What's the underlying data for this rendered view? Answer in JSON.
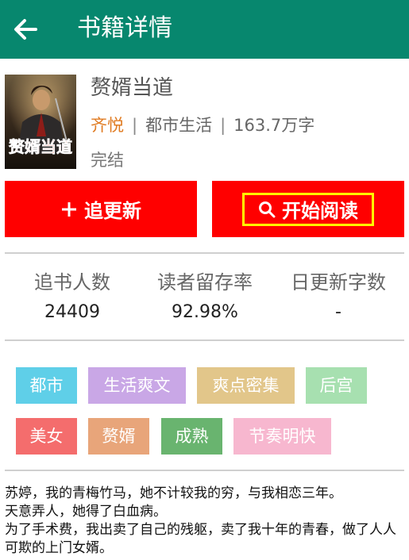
{
  "appbar": {
    "title": "书籍详情"
  },
  "book": {
    "title": "赘婿当道",
    "author": "齐悦",
    "category": "都市生活",
    "word_count": "163.7万字",
    "status": "完结",
    "cover_text": "赘婿当道"
  },
  "actions": {
    "follow_label": "追更新",
    "read_label": "开始阅读"
  },
  "stats": [
    {
      "label": "追书人数",
      "value": "24409"
    },
    {
      "label": "读者留存率",
      "value": "92.98%"
    },
    {
      "label": "日更新字数",
      "value": "-"
    }
  ],
  "tags": [
    {
      "label": "都市",
      "color": "#5fcfe8"
    },
    {
      "label": "生活爽文",
      "color": "#c9a7e6"
    },
    {
      "label": "爽点密集",
      "color": "#e2c68a"
    },
    {
      "label": "后宫",
      "color": "#a7e0b0"
    },
    {
      "label": "美女",
      "color": "#f46d6d"
    },
    {
      "label": "赘婿",
      "color": "#e8a57a"
    },
    {
      "label": "成熟",
      "color": "#69b46f"
    },
    {
      "label": "节奏明快",
      "color": "#f7b7cf"
    }
  ],
  "intro": [
    "苏婷，我的青梅竹马，她不计较我的穷，与我相恋三年。",
    "天意弄人，她得了白血病。",
    "为了手术费，我出卖了自己的残躯，卖了我十年的青春，做了人人可欺的上门女婿。"
  ],
  "colors": {
    "appbar": "#07876e",
    "button": "#ff0000",
    "author": "#e07b22",
    "highlight": "#ffff00"
  },
  "icons": {
    "back": "arrow-left-icon",
    "follow": "plus-icon",
    "read": "search-icon"
  }
}
